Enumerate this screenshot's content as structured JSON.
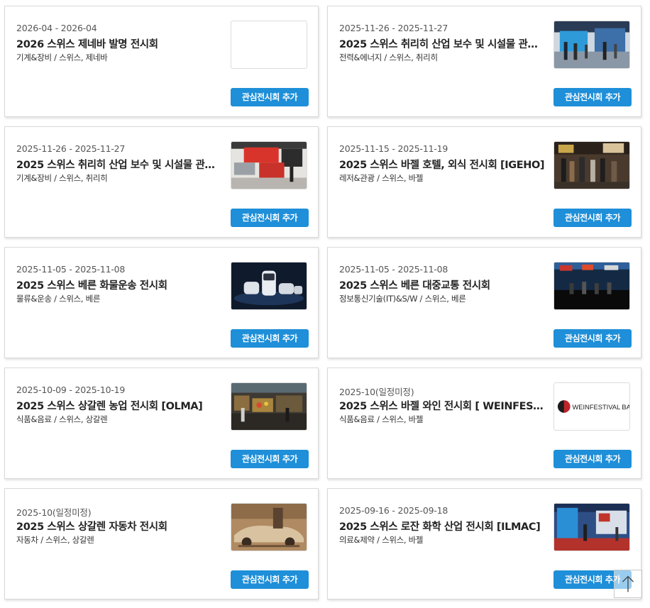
{
  "exhibitions": [
    {
      "date": "2026-04 - 2026-04",
      "title": "2026 스위스 제네바 발명 전시회",
      "category": "기계&장비 / 스위스, 제네바",
      "button": "관심전시회 추가",
      "image": "blank"
    },
    {
      "date": "2025-11-26 - 2025-11-27",
      "title": "2025 스위스 취리히 산업 보수 및 시설물 관리 …",
      "category": "전력&에너지 / 스위스, 취리히",
      "button": "관심전시회 추가",
      "image": "exhibition-hall-photo"
    },
    {
      "date": "2025-11-26 - 2025-11-27",
      "title": "2025 스위스 취리히 산업 보수 및 시설물 관리 …",
      "category": "기계&장비 / 스위스, 취리히",
      "button": "관심전시회 추가",
      "image": "booth-photo"
    },
    {
      "date": "2025-11-15 - 2025-11-19",
      "title": "2025 스위스 바젤 호텔, 외식 전시회 [IGEHO]",
      "category": "레저&관광 / 스위스, 바젤",
      "button": "관심전시회 추가",
      "image": "crowd-photo"
    },
    {
      "date": "2025-11-05 - 2025-11-08",
      "title": "2025 스위스 베른 화물운송 전시회",
      "category": "물류&운송 / 스위스, 베른",
      "button": "관심전시회 추가",
      "image": "vehicle-render"
    },
    {
      "date": "2025-11-05 - 2025-11-08",
      "title": "2025 스위스 베른 대중교통 전시회",
      "category": "정보통신기술(IT)&S/W / 스위스, 베른",
      "button": "관심전시회 추가",
      "image": "conference-stage-photo"
    },
    {
      "date": "2025-10-09 - 2025-10-19",
      "title": "2025 스위스 상갈렌 농업 전시회 [OLMA]",
      "category": "식품&음료 / 스위스, 상갈렌",
      "button": "관심전시회 추가",
      "image": "market-hall-photo"
    },
    {
      "date": "2025-10(일정미정)",
      "title": "2025 스위스 바젤 와인 전시회 [ WEINFESTI…",
      "category": "식품&음료 / 스위스, 바젤",
      "button": "관심전시회 추가",
      "image": "weinfestival-logo",
      "logo_text": "WEINFESTIVAL BASEL"
    },
    {
      "date": "2025-10(일정미정)",
      "title": "2025 스위스 상갈렌 자동차 전시회",
      "category": "자동차 / 스위스, 상갈렌",
      "button": "관심전시회 추가",
      "image": "vintage-car-photo"
    },
    {
      "date": "2025-09-16 - 2025-09-18",
      "title": "2025 스위스 로잔 화학 산업 전시회 [ILMAC]",
      "category": "의료&제약 / 스위스, 바젤",
      "button": "관심전시회 추가",
      "image": "expo-booth-photo"
    }
  ],
  "colors": {
    "accent": "#1e8fd8",
    "card_border": "#d9d9d9"
  },
  "scroll_top_icon": "arrow-up-icon"
}
